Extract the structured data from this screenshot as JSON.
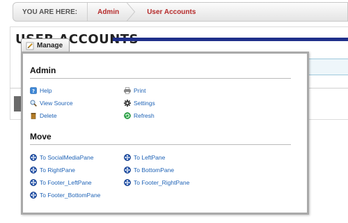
{
  "breadcrumb": {
    "prefix": "YOU ARE HERE:",
    "items": [
      "Admin",
      "User Accounts"
    ]
  },
  "page": {
    "title": "USER ACCOUNTS",
    "accent_color": "#1f2f8a"
  },
  "manage": {
    "label": "Manage"
  },
  "admin_section": {
    "title": "Admin",
    "items": [
      {
        "label": "Help",
        "icon": "help-icon"
      },
      {
        "label": "Print",
        "icon": "printer-icon"
      },
      {
        "label": "View Source",
        "icon": "magnifier-icon"
      },
      {
        "label": "Settings",
        "icon": "gear-icon"
      },
      {
        "label": "Delete",
        "icon": "trash-icon"
      },
      {
        "label": "Refresh",
        "icon": "refresh-icon"
      }
    ]
  },
  "move_section": {
    "title": "Move",
    "items": [
      {
        "label": "To SocialMediaPane",
        "icon": "move-arrows-icon"
      },
      {
        "label": "To LeftPane",
        "icon": "move-arrows-icon"
      },
      {
        "label": "To RightPane",
        "icon": "move-arrows-icon"
      },
      {
        "label": "To BottomPane",
        "icon": "move-arrows-icon"
      },
      {
        "label": "To Footer_LeftPane",
        "icon": "move-arrows-icon"
      },
      {
        "label": "To Footer_RightPane",
        "icon": "move-arrows-icon"
      },
      {
        "label": "To Footer_BottomPane",
        "icon": "move-arrows-icon"
      }
    ]
  },
  "colors": {
    "link": "#1f63b6",
    "breadcrumb_link": "#b52a2a"
  }
}
